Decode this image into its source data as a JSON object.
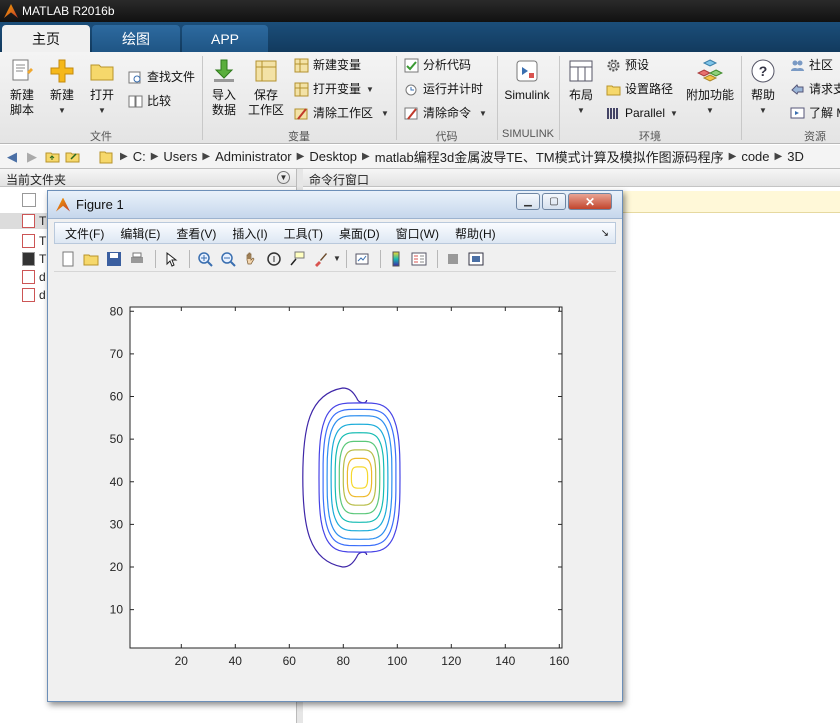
{
  "window": {
    "title": "MATLAB R2016b"
  },
  "main_tabs": [
    {
      "label": "主页"
    },
    {
      "label": "绘图"
    },
    {
      "label": "APP"
    }
  ],
  "ribbon": {
    "new_script": {
      "line1": "新建",
      "line2": "脚本"
    },
    "new": {
      "label": "新建"
    },
    "open": {
      "label": "打开"
    },
    "find_files": "查找文件",
    "compare": "比较",
    "import_data": {
      "line1": "导入",
      "line2": "数据"
    },
    "save_workspace": {
      "line1": "保存",
      "line2": "工作区"
    },
    "new_variable": "新建变量",
    "open_variable": "打开变量",
    "clear_workspace": "清除工作区",
    "analyze_code": "分析代码",
    "run_and_time": "运行并计时",
    "clear_commands": "清除命令",
    "simulink": "Simulink",
    "layout": "布局",
    "preferences": "预设",
    "set_path": "设置路径",
    "parallel": "Parallel",
    "addons": "附加功能",
    "help": "帮助",
    "community": "社区",
    "request_support": "请求支",
    "learn": "了解 M",
    "groups": {
      "file": "文件",
      "variable": "变量",
      "code": "代码",
      "simulink": "SIMULINK",
      "environment": "环境",
      "resources": "资源"
    }
  },
  "address_bar": {
    "path": [
      "C:",
      "Users",
      "Administrator",
      "Desktop",
      "matlab编程3d金属波导TE、TM模式计算及模拟作图源码程序",
      "code",
      "3D"
    ]
  },
  "current_folder": {
    "header": "当前文件夹",
    "files": [
      "T",
      "T",
      "T",
      "d",
      "d"
    ]
  },
  "command_window": {
    "header": "命令行窗口"
  },
  "figure": {
    "title": "Figure 1",
    "menus": [
      "文件(F)",
      "编辑(E)",
      "查看(V)",
      "插入(I)",
      "工具(T)",
      "桌面(D)",
      "窗口(W)",
      "帮助(H)"
    ],
    "toolbar_icons": [
      "new-figure-icon",
      "open-file-icon",
      "save-icon",
      "print-icon",
      "select-arrow-icon",
      "zoom-in-icon",
      "zoom-out-icon",
      "pan-hand-icon",
      "rotate-3d-icon",
      "data-cursor-icon",
      "brush-icon",
      "link-plot-icon",
      "colorbar-icon",
      "legend-icon",
      "hide-plot-tools-icon",
      "show-plot-tools-icon"
    ]
  },
  "chart_data": {
    "type": "contour",
    "title": "",
    "xlabel": "",
    "ylabel": "",
    "xlim": [
      1,
      161
    ],
    "ylim": [
      1,
      81
    ],
    "xticks": [
      20,
      40,
      60,
      80,
      100,
      120,
      140,
      160
    ],
    "yticks": [
      10,
      20,
      30,
      40,
      50,
      60,
      70,
      80
    ],
    "grid": false,
    "colormap": "parula",
    "center": [
      86,
      41
    ],
    "levels": [
      {
        "level": 1,
        "color": "#3e26a8",
        "halfwidth_x": 21,
        "halfheight_y": 21,
        "outer": true
      },
      {
        "level": 2,
        "color": "#4743e6",
        "halfwidth_x": 15,
        "halfheight_y": 17.5
      },
      {
        "level": 3,
        "color": "#3b6ffa",
        "halfwidth_x": 13.5,
        "halfheight_y": 16
      },
      {
        "level": 4,
        "color": "#2c8ef0",
        "halfwidth_x": 12,
        "halfheight_y": 14.5
      },
      {
        "level": 5,
        "color": "#1bacd9",
        "halfwidth_x": 10.5,
        "halfheight_y": 12.5
      },
      {
        "level": 6,
        "color": "#16bcb3",
        "halfwidth_x": 9,
        "halfheight_y": 10.5
      },
      {
        "level": 7,
        "color": "#5bc87a",
        "halfwidth_x": 7.5,
        "halfheight_y": 8.5
      },
      {
        "level": 8,
        "color": "#b7bd48",
        "halfwidth_x": 6,
        "halfheight_y": 6.5
      },
      {
        "level": 9,
        "color": "#eeb92b",
        "halfwidth_x": 4.5,
        "halfheight_y": 4.5
      },
      {
        "level": 10,
        "color": "#f6d92e",
        "halfwidth_x": 3,
        "halfheight_y": 2.5
      }
    ]
  }
}
